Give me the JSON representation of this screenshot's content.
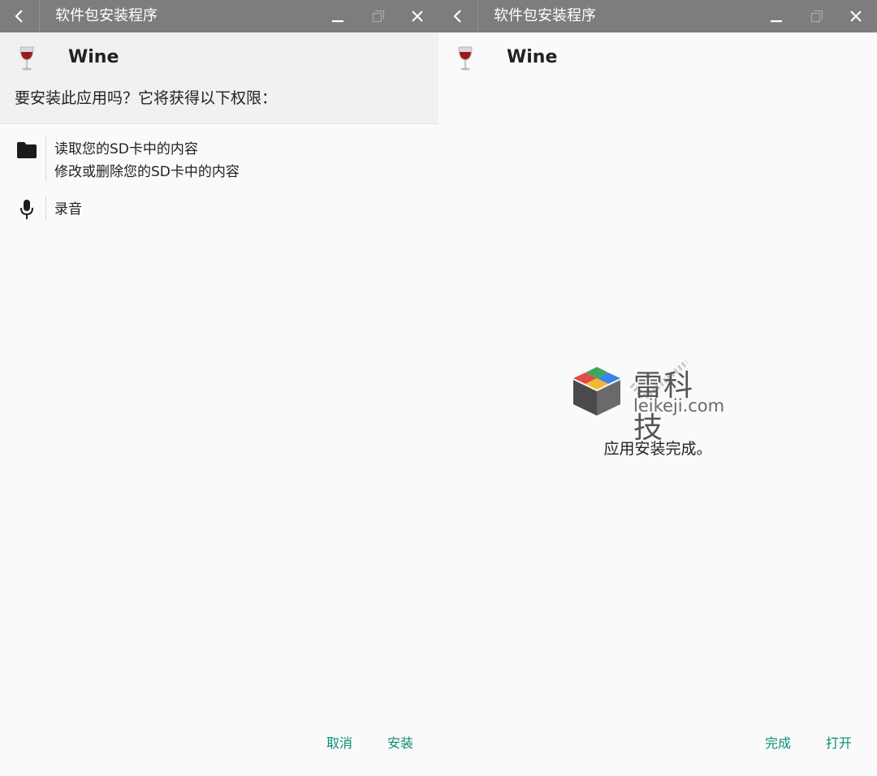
{
  "left_window": {
    "title": "软件包安装程序",
    "app_name": "Wine",
    "question": "要安装此应用吗？它将获得以下权限：",
    "permissions": [
      {
        "icon": "folder-icon",
        "lines": [
          "读取您的SD卡中的内容",
          "修改或删除您的SD卡中的内容"
        ]
      },
      {
        "icon": "microphone-icon",
        "lines": [
          "录音"
        ]
      }
    ],
    "cancel_label": "取消",
    "install_label": "安装"
  },
  "right_window": {
    "title": "软件包安装程序",
    "app_name": "Wine",
    "watermark_cn": "雷科技",
    "watermark_en": "leikeji.com",
    "status": "应用安装完成。",
    "done_label": "完成",
    "open_label": "打开"
  },
  "colors": {
    "titlebar": "#7d7d7d",
    "accent": "#0b8f78",
    "background": "#fafafa"
  }
}
